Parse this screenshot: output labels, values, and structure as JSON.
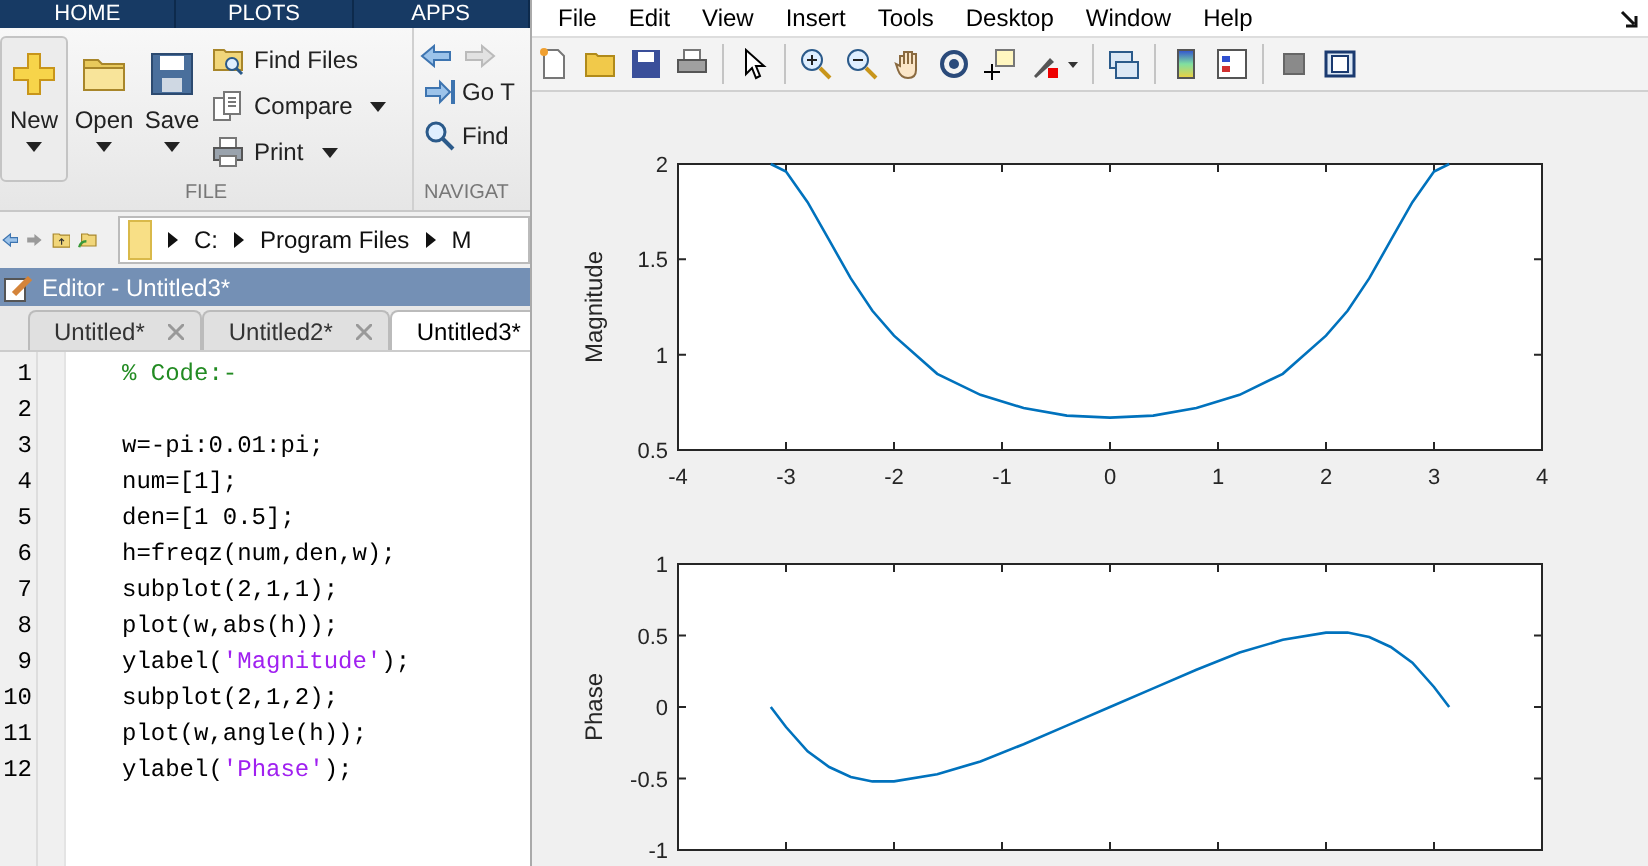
{
  "ribbon_tabs": [
    "HOME",
    "PLOTS",
    "APPS"
  ],
  "ribbon": {
    "file_group": {
      "large_buttons": [
        {
          "label": "New",
          "kind": "new"
        },
        {
          "label": "Open",
          "kind": "open"
        },
        {
          "label": "Save",
          "kind": "save"
        }
      ],
      "small_buttons": [
        {
          "label": "Find Files",
          "kind": "find",
          "dropdown": false
        },
        {
          "label": "Compare",
          "kind": "compare",
          "dropdown": true
        },
        {
          "label": "Print",
          "kind": "print",
          "dropdown": true
        }
      ],
      "label": "FILE"
    },
    "navigate_group": {
      "buttons": [
        {
          "label": "Go T",
          "kind": "goto"
        },
        {
          "label": "Find",
          "kind": "find"
        }
      ],
      "label": "NAVIGAT"
    }
  },
  "address_bar": {
    "path": [
      "C:",
      "Program Files",
      "M"
    ]
  },
  "editor": {
    "title": "Editor - Untitled3*",
    "tabs": [
      {
        "label": "Untitled*",
        "selected": false
      },
      {
        "label": "Untitled2*",
        "selected": false
      },
      {
        "label": "Untitled3*",
        "selected": true
      }
    ],
    "lines": [
      {
        "number": "1",
        "segments": [
          {
            "kind": "comment",
            "text": "% Code:-"
          }
        ]
      },
      {
        "number": "2"
      },
      {
        "number": "3",
        "segments": [
          {
            "kind": "code",
            "text": "w=-pi:0.01:pi;"
          }
        ]
      },
      {
        "number": "4",
        "segments": [
          {
            "kind": "code",
            "text": "num=[1];"
          }
        ]
      },
      {
        "number": "5",
        "segments": [
          {
            "kind": "code",
            "text": "den=[1 0.5];"
          }
        ]
      },
      {
        "number": "6",
        "segments": [
          {
            "kind": "code",
            "text": "h=freqz(num,den,w);"
          }
        ]
      },
      {
        "number": "7",
        "segments": [
          {
            "kind": "code",
            "text": "subplot(2,1,1);"
          }
        ]
      },
      {
        "number": "8",
        "segments": [
          {
            "kind": "code",
            "text": "plot(w,abs(h));"
          }
        ]
      },
      {
        "number": "9",
        "segments": [
          {
            "kind": "code",
            "text": "ylabel("
          },
          {
            "kind": "string",
            "text": "'Magnitude'"
          },
          {
            "kind": "code",
            "text": ");"
          }
        ]
      },
      {
        "number": "10",
        "segments": [
          {
            "kind": "code",
            "text": "subplot(2,1,2);"
          }
        ]
      },
      {
        "number": "11",
        "segments": [
          {
            "kind": "code",
            "text": "plot(w,angle(h));"
          }
        ]
      },
      {
        "number": "12",
        "segments": [
          {
            "kind": "code",
            "text": "ylabel("
          },
          {
            "kind": "string",
            "text": "'Phase'"
          },
          {
            "kind": "code",
            "text": ");"
          }
        ]
      }
    ]
  },
  "figure": {
    "menu": [
      "File",
      "Edit",
      "View",
      "Insert",
      "Tools",
      "Desktop",
      "Window",
      "Help"
    ],
    "axes": [
      {
        "chart_data": {
          "type": "line",
          "ylabel": "Magnitude",
          "x": [
            -3.14,
            -3.0,
            -2.8,
            -2.6,
            -2.4,
            -2.2,
            -2.0,
            -1.6,
            -1.2,
            -0.8,
            -0.4,
            0,
            0.4,
            0.8,
            1.2,
            1.6,
            2.0,
            2.2,
            2.4,
            2.6,
            2.8,
            3.0,
            3.14
          ],
          "series": [
            {
              "color": "#0072bd",
              "values": [
                2.0,
                1.96,
                1.8,
                1.6,
                1.4,
                1.23,
                1.1,
                0.9,
                0.79,
                0.72,
                0.68,
                0.67,
                0.68,
                0.72,
                0.79,
                0.9,
                1.1,
                1.23,
                1.4,
                1.6,
                1.8,
                1.96,
                2.0
              ]
            }
          ],
          "xlim": [
            -4,
            4
          ],
          "ylim": [
            0.5,
            2
          ],
          "xticks": [
            -4,
            -3,
            -2,
            -1,
            0,
            1,
            2,
            3,
            4
          ],
          "yticks": [
            0.5,
            1,
            1.5,
            2
          ]
        }
      },
      {
        "chart_data": {
          "type": "line",
          "ylabel": "Phase",
          "x": [
            -3.14,
            -3.0,
            -2.8,
            -2.6,
            -2.4,
            -2.2,
            -2.0,
            -1.6,
            -1.2,
            -0.8,
            -0.4,
            0,
            0.4,
            0.8,
            1.2,
            1.6,
            2.0,
            2.2,
            2.4,
            2.6,
            2.8,
            3.0,
            3.14
          ],
          "series": [
            {
              "color": "#0072bd",
              "values": [
                0,
                -0.14,
                -0.31,
                -0.42,
                -0.49,
                -0.52,
                -0.52,
                -0.47,
                -0.38,
                -0.26,
                -0.13,
                0,
                0.13,
                0.26,
                0.38,
                0.47,
                0.52,
                0.52,
                0.49,
                0.42,
                0.31,
                0.14,
                0
              ]
            }
          ],
          "xlim": [
            -4,
            4
          ],
          "ylim": [
            -1,
            1
          ],
          "yticks": [
            -1,
            -0.5,
            0,
            0.5,
            1
          ]
        }
      }
    ]
  }
}
